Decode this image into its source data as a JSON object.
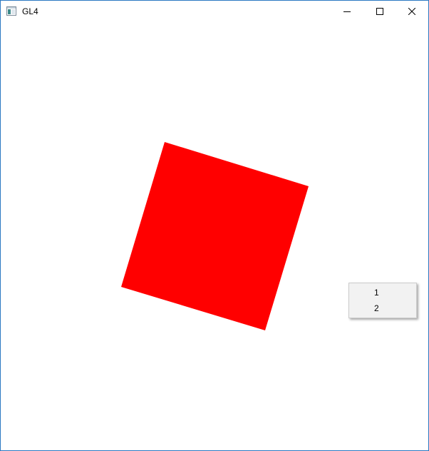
{
  "window": {
    "title": "GL4",
    "border_color": "#2b79c2",
    "icon": "window-app-icon",
    "controls": {
      "minimize_icon": "minimize-icon",
      "maximize_icon": "maximize-icon",
      "close_icon": "close-icon"
    }
  },
  "scene": {
    "shape": "square",
    "fill_color": "#ff0000",
    "rotation_deg": 18,
    "background_color": "#ffffff"
  },
  "context_menu": {
    "items": [
      {
        "label": "1"
      },
      {
        "label": "2"
      }
    ]
  }
}
